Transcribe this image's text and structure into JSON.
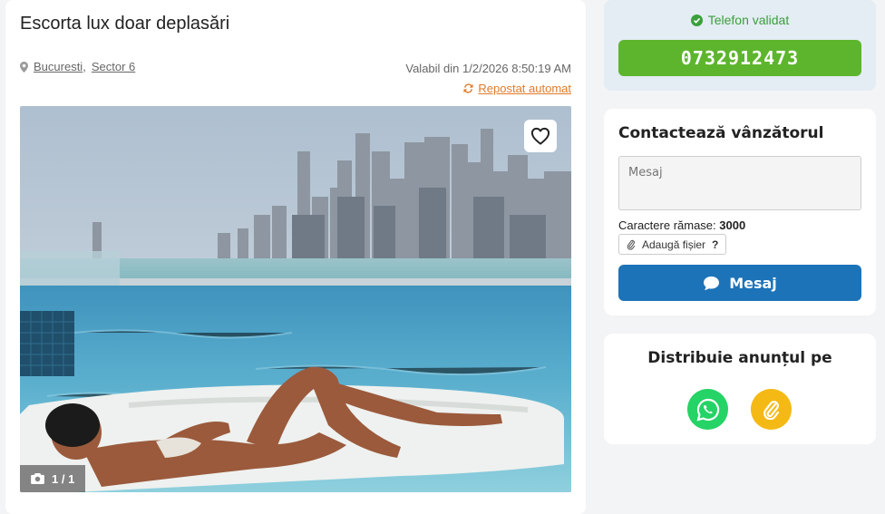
{
  "listing": {
    "title": "Escorta lux doar deplasări",
    "location_city": "Bucuresti",
    "location_sector": "Sector 6",
    "location_sep": ",",
    "valid_text": "Valabil din 1/2/2026 8:50:19 AM",
    "repost_label": "Repostat automat",
    "photo_counter": "1 / 1"
  },
  "phone": {
    "validated_label": "Telefon validat",
    "number": "0732912473",
    "accent": "#5db52d"
  },
  "contact": {
    "title": "Contactează vânzătorul",
    "message_placeholder": "Mesaj",
    "chars_label": "Caractere rămase:",
    "chars_value": "3000",
    "attach_label": "Adaugă fișier",
    "attach_help": "?",
    "send_label": "Mesaj",
    "accent": "#1c73b8"
  },
  "share": {
    "title": "Distribuie anunțul pe",
    "buttons": [
      {
        "icon": "whatsapp-icon",
        "color": "#25d366"
      },
      {
        "icon": "paperclip-icon",
        "color": "#f4b915"
      }
    ]
  },
  "icons": {
    "location": "map-pin-icon",
    "repost": "refresh-icon",
    "favorite": "heart-icon",
    "camera": "camera-icon",
    "validated": "check-circle-icon",
    "send": "chat-bubble-icon",
    "attach": "paperclip-icon"
  }
}
